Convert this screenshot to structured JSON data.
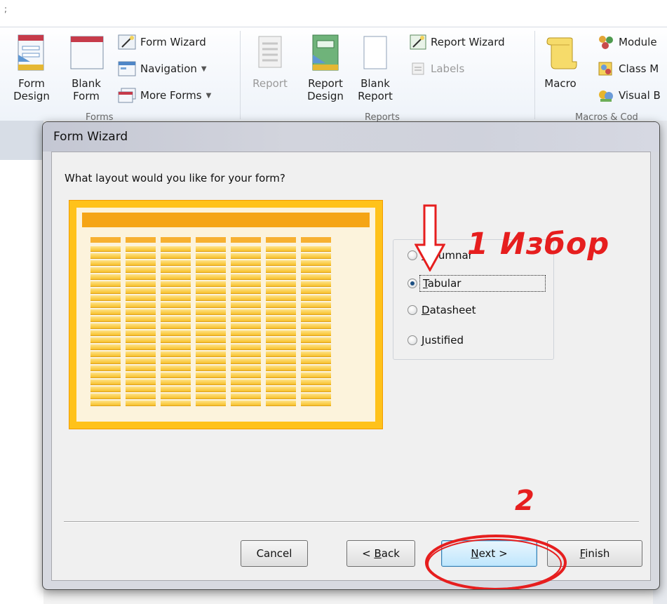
{
  "ribbon": {
    "top_mark": ";",
    "forms": {
      "form_design": [
        "Form",
        "Design"
      ],
      "blank_form": [
        "Blank",
        "Form"
      ],
      "form_wizard": "Form Wizard",
      "navigation": "Navigation",
      "more_forms": "More Forms",
      "group_label": "Forms"
    },
    "reports": {
      "report": "Report",
      "report_design": [
        "Report",
        "Design"
      ],
      "blank_report": [
        "Blank",
        "Report"
      ],
      "report_wizard": "Report Wizard",
      "labels": "Labels",
      "group_label": "Reports"
    },
    "macros": {
      "macro": "Macro",
      "module": "Module",
      "class_module": "Class M",
      "visual_basic": "Visual B",
      "group_label": "Macros & Cod"
    },
    "colors": {
      "accent": "#1d4f82"
    }
  },
  "dialog": {
    "title": "Form Wizard",
    "question": "What layout would you like for your form?",
    "options": [
      {
        "label": "Columnar",
        "mnemonic": "C",
        "rest": "olumnar",
        "checked": false
      },
      {
        "label": "Tabular",
        "mnemonic": "T",
        "rest": "abular",
        "checked": true
      },
      {
        "label": "Datasheet",
        "mnemonic": "D",
        "rest": "atasheet",
        "checked": false
      },
      {
        "label": "Justified",
        "mnemonic": "J",
        "rest": "ustified",
        "checked": false
      }
    ],
    "buttons": {
      "cancel": "Cancel",
      "back_prefix": "< ",
      "back_mnemonic": "B",
      "back_rest": "ack",
      "next_mnemonic": "N",
      "next_rest": "ext >",
      "finish_mnemonic": "F",
      "finish_rest": "inish"
    },
    "preview": {
      "columns": 7,
      "rows": 23,
      "colors": {
        "frame": "#ffc21a",
        "header": "#f5a516",
        "cell": "#f7c12b"
      }
    }
  },
  "annotations": {
    "step1": "1 Избор",
    "step2": "2",
    "color": "#e61e1e"
  }
}
